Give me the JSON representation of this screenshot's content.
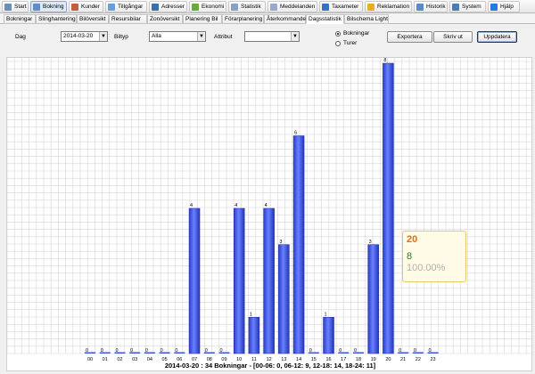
{
  "toolbar": {
    "items": [
      {
        "label": "Start",
        "icon": "home-icon",
        "color": "#6a8fb8"
      },
      {
        "label": "Bokning",
        "icon": "refresh-icon",
        "color": "#5f8ccc"
      },
      {
        "label": "Kunder",
        "icon": "people-icon",
        "color": "#c06040"
      },
      {
        "label": "Tillgångar",
        "icon": "car-icon",
        "color": "#6aa0d8"
      },
      {
        "label": "Adresser",
        "icon": "map-icon",
        "color": "#3a6fb0"
      },
      {
        "label": "Ekonomi",
        "icon": "money-icon",
        "color": "#6aaa3a"
      },
      {
        "label": "Statistik",
        "icon": "chart-icon",
        "color": "#8aa0c0"
      },
      {
        "label": "Meddelanden",
        "icon": "message-icon",
        "color": "#9aa9c9"
      },
      {
        "label": "Taxameter",
        "icon": "taximeter-icon",
        "color": "#3a70c0"
      },
      {
        "label": "Reklamation",
        "icon": "smiley-icon",
        "color": "#e8b020"
      },
      {
        "label": "Historik",
        "icon": "history-icon",
        "color": "#5a8ac8"
      },
      {
        "label": "System",
        "icon": "system-icon",
        "color": "#4a7ab8"
      },
      {
        "label": "Hjälp",
        "icon": "help-icon",
        "color": "#2a7ad8"
      }
    ]
  },
  "subtabs": [
    "Bokningar",
    "Slinghantering",
    "Bilöversikt",
    "Resursbilar",
    "Zonöversikt",
    "Planering Bil",
    "Förarplanering",
    "Återkommande",
    "Dagsstatistik",
    "Bilschema Light"
  ],
  "filter": {
    "day_label": "Dag",
    "day_value": "2014-03-20",
    "cartype_label": "Biltyp",
    "cartype_value": "Alla",
    "attribute_label": "Attribut",
    "attribute_value": "",
    "radio_bookings": "Bokningar",
    "radio_trips": "Turer",
    "selected_radio": "Bokningar",
    "export_label": "Exportera",
    "print_label": "Skriv ut",
    "update_label": "Uppdatera"
  },
  "chart_data": {
    "type": "bar",
    "categories": [
      "00",
      "01",
      "02",
      "03",
      "04",
      "05",
      "06",
      "07",
      "08",
      "09",
      "10",
      "11",
      "12",
      "13",
      "14",
      "15",
      "16",
      "17",
      "18",
      "19",
      "20",
      "21",
      "22",
      "23"
    ],
    "values": [
      0,
      0,
      0,
      0,
      0,
      0,
      0,
      4,
      0,
      0,
      4,
      1,
      4,
      3,
      6,
      0,
      1,
      0,
      0,
      3,
      8,
      0,
      0,
      0
    ],
    "ylim": [
      0,
      8
    ],
    "grid": true,
    "bar_color": "#3c55e0",
    "footer": "2014-03-20 : 34 Bokningar - [00-06: 0, 06-12: 9, 12-18: 14, 18-24: 11]"
  },
  "tooltip": {
    "hour": "20",
    "count": "8",
    "percent": "100.00%"
  }
}
